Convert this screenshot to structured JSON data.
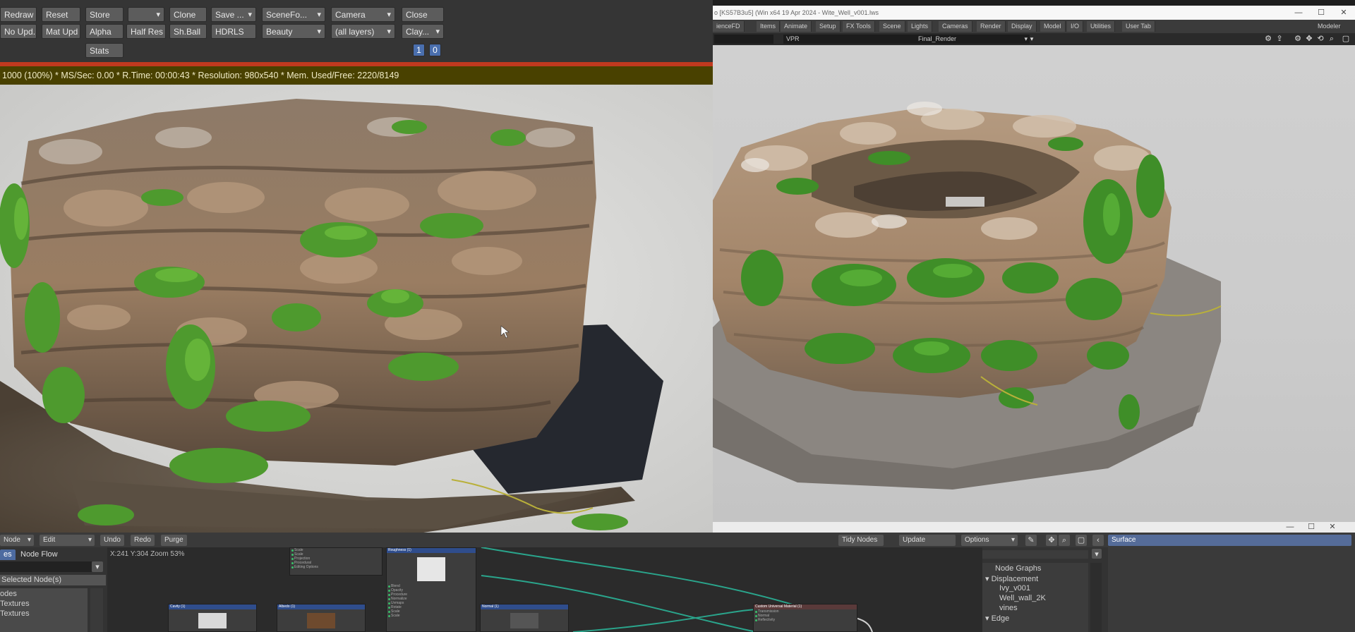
{
  "render_window": {
    "toolbar": {
      "redraw": "Redraw",
      "reset": "Reset",
      "store": "Store",
      "store_dropdown": "",
      "clone": "Clone",
      "save": "Save ...",
      "scene_format": "SceneFo...",
      "camera": "Camera",
      "close": "Close",
      "no_update": "No Upd.",
      "mat_update": "Mat Upd",
      "alpha": "Alpha",
      "half_res": "Half Res",
      "sh_ball": "Sh.Ball",
      "hdrls": "HDRLS",
      "buffer": "Beauty",
      "layers": "(all layers)",
      "clay": "Clay...",
      "stats": "Stats",
      "page_1": "1",
      "page_0": "0"
    },
    "status": "1000 (100%)  *  MS/Sec: 0.00  *  R.Time: 00:00:43  *  Resolution: 980x540  *  Mem. Used/Free: 2220/8149"
  },
  "vpr_window": {
    "title": "o [KS57B3u5] (Win x64 19 Apr 2024 - Wite_Well_v001.lws",
    "window_controls": {
      "minimize": "—",
      "maximize": "☐",
      "close": "✕"
    },
    "menu_tabs": [
      "ienceFD",
      "Items",
      "Animate",
      "Setup",
      "FX Tools",
      "Scene",
      "Lights",
      "Cameras",
      "Render",
      "Display",
      "Model",
      "I/O",
      "Utilities",
      "User Tab"
    ],
    "modeler_label": "Modeler",
    "view_mode": "VPR",
    "render_mode": "Final_Render"
  },
  "node_editor": {
    "toolbar": {
      "node_menu": "Node",
      "edit_menu": "Edit",
      "undo": "Undo",
      "redo": "Redo",
      "purge": "Purge",
      "tidy_nodes": "Tidy Nodes",
      "update": "Update",
      "options": "Options",
      "surface_field": "Surface"
    },
    "tabs": {
      "nodes_tab": "es",
      "node_flow_tab": "Node Flow"
    },
    "selected_nodes_label": "Selected Node(s)",
    "node_list": [
      "odes",
      "Textures",
      "Textures"
    ],
    "canvas_info": "X:241 Y:304 Zoom 53%",
    "nodes": {
      "roughness": {
        "title": "Roughness (1)",
        "ports": [
          "Blend",
          "Opacity",
          "Procedure",
          "Normalize",
          "Uvmaps",
          "Rotate",
          "Scale",
          "Scale"
        ]
      },
      "top_node": {
        "ports": [
          "Scale",
          "Scale",
          "Projection",
          "Procedural",
          "Editing Options"
        ]
      },
      "cavity": {
        "title": "Cavity (1)"
      },
      "albedo": {
        "title": "Albedo (1)"
      },
      "normal": {
        "title": "Normal (1)"
      },
      "universal": {
        "title": "Custom Universal Material (1)",
        "ports": [
          "Transmission",
          "Normal",
          "Reflectivity"
        ]
      }
    },
    "node_graphs": {
      "header": "Node Graphs",
      "displacement": "Displacement",
      "items": [
        "Ivy_v001",
        "Well_wall_2K",
        "vines"
      ],
      "edge": "Edge"
    }
  },
  "colors": {
    "progress_bar": "#c0391f",
    "status_bar_bg": "#494100",
    "accent_blue": "#4a6fae",
    "ivy_green": "#4e9a2e",
    "node_header": "#2f4d8c"
  }
}
